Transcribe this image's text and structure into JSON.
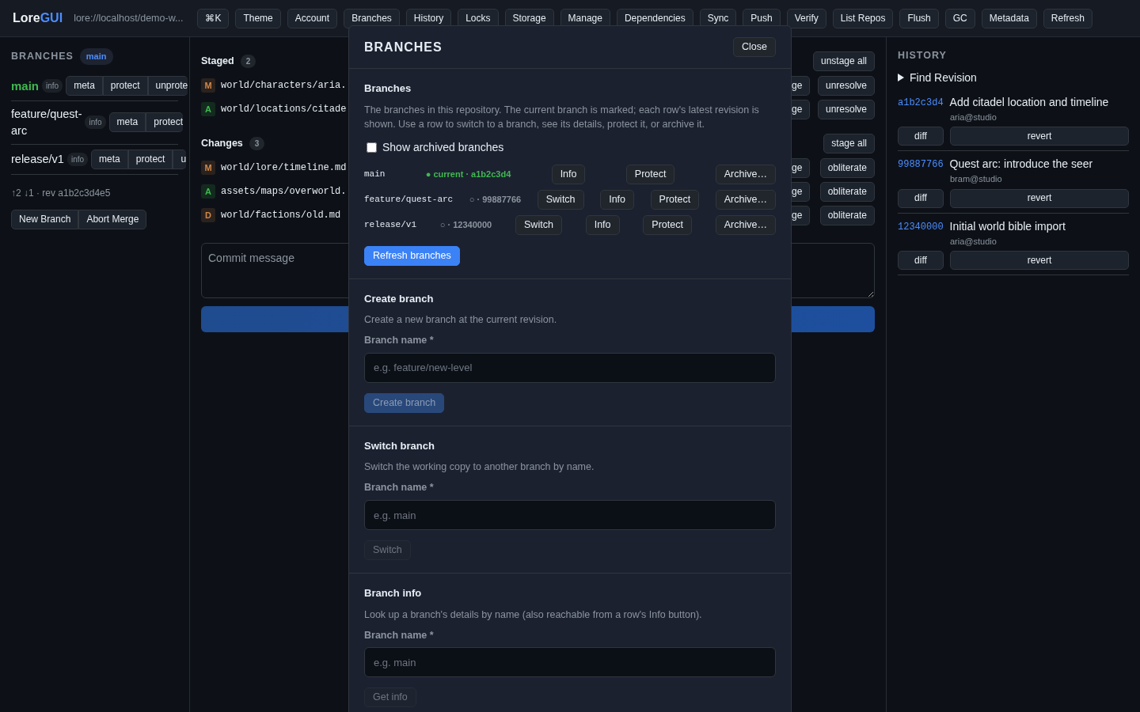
{
  "app": {
    "logo_plain": "Lore",
    "logo_accent": "GUI",
    "repo_url": "lore://localhost/demo-w..."
  },
  "toolbar": [
    "⌘K",
    "Theme",
    "Account",
    "Branches",
    "History",
    "Locks",
    "Storage",
    "Manage",
    "Dependencies",
    "Sync",
    "Push",
    "Verify",
    "List Repos",
    "Flush",
    "GC",
    "Metadata",
    "Refresh"
  ],
  "branches_panel": {
    "title": "BRANCHES",
    "current_badge": "main",
    "branches": [
      {
        "name": "main",
        "current": true,
        "info": "info",
        "actions": [
          {
            "label": "meta"
          },
          {
            "label": "protect"
          },
          {
            "label": "unprote"
          }
        ]
      },
      {
        "name": "feature/quest-arc",
        "current": false,
        "info": "info",
        "actions": [
          {
            "label": "meta"
          },
          {
            "label": "protect"
          }
        ]
      },
      {
        "name": "release/v1",
        "current": false,
        "info": "info",
        "actions": [
          {
            "label": "meta"
          },
          {
            "label": "protect"
          },
          {
            "label": "u"
          }
        ]
      }
    ],
    "status": "↑2 ↓1 · rev a1b2c3d4e5",
    "buttons": [
      "New Branch",
      "Abort Merge"
    ]
  },
  "workspace": {
    "sections": [
      {
        "title": "Staged",
        "count": "2",
        "bulk_action": "unstage all",
        "files": [
          {
            "status": "M",
            "color": "#d0884a",
            "path": "world/characters/aria.",
            "actions": [
              "ge",
              "unresolve"
            ]
          },
          {
            "status": "A",
            "color": "#3fb950",
            "path": "world/locations/citade",
            "actions": [
              "ge",
              "unresolve"
            ]
          }
        ]
      },
      {
        "title": "Changes",
        "count": "3",
        "bulk_action": "stage all",
        "files": [
          {
            "status": "M",
            "color": "#d0884a",
            "path": "world/lore/timeline.md",
            "actions": [
              "ge",
              "obliterate"
            ]
          },
          {
            "status": "A",
            "color": "#3fb950",
            "path": "assets/maps/overworld.",
            "actions": [
              "ge",
              "obliterate"
            ]
          },
          {
            "status": "D",
            "color": "#d0884a",
            "path": "world/factions/old.md",
            "actions": [
              "ge",
              "obliterate"
            ]
          }
        ]
      }
    ],
    "commit_placeholder": "Commit message"
  },
  "history": {
    "title": "HISTORY",
    "find": "Find Revision",
    "expanded": false,
    "revisions": [
      {
        "hash": "a1b2c3d4",
        "message": "Add citadel location and timeline",
        "author": "aria@studio",
        "actions": [
          "diff",
          "revert"
        ]
      },
      {
        "hash": "99887766",
        "message": "Quest arc: introduce the seer",
        "author": "bram@studio",
        "actions": [
          "diff",
          "revert"
        ]
      },
      {
        "hash": "12340000",
        "message": "Initial world bible import",
        "author": "aria@studio",
        "actions": [
          "diff",
          "revert"
        ]
      }
    ]
  },
  "modal": {
    "title": "BRANCHES",
    "close": "Close",
    "sections": [
      {
        "kind": "list",
        "title": "Branches",
        "description": "The branches in this repository. The current branch is marked; each row's latest revision is shown. Use a row to switch to a branch, see its details, protect it, or archive it.",
        "checkbox": {
          "label": "Show archived branches",
          "checked": false
        },
        "rows": [
          {
            "name": "main",
            "current": true,
            "status": "● current · a1b2c3d4",
            "actions": [
              "Info",
              "Protect",
              "Archive…"
            ]
          },
          {
            "name": "feature/quest-arc",
            "current": false,
            "status": "○ · 99887766",
            "actions": [
              "Switch",
              "Info",
              "Protect",
              "Archive…"
            ]
          },
          {
            "name": "release/v1",
            "current": false,
            "status": "○ · 12340000",
            "actions": [
              "Switch",
              "Info",
              "Protect",
              "Archive…"
            ]
          }
        ],
        "button": {
          "label": "Refresh branches",
          "disabled": false
        }
      },
      {
        "kind": "form",
        "title": "Create branch",
        "description": "Create a new branch at the current revision.",
        "field_label": "Branch name *",
        "placeholder": "e.g. feature/new-level",
        "button": {
          "label": "Create branch",
          "disabled": true
        }
      },
      {
        "kind": "form",
        "title": "Switch branch",
        "description": "Switch the working copy to another branch by name.",
        "field_label": "Branch name *",
        "placeholder": "e.g. main",
        "button": {
          "label": "Switch",
          "disabled": true
        }
      },
      {
        "kind": "form",
        "title": "Branch info",
        "description": "Look up a branch's details by name (also reachable from a row's Info button).",
        "field_label": "Branch name *",
        "placeholder": "e.g. main",
        "button": {
          "label": "Get info",
          "disabled": true
        }
      }
    ]
  }
}
